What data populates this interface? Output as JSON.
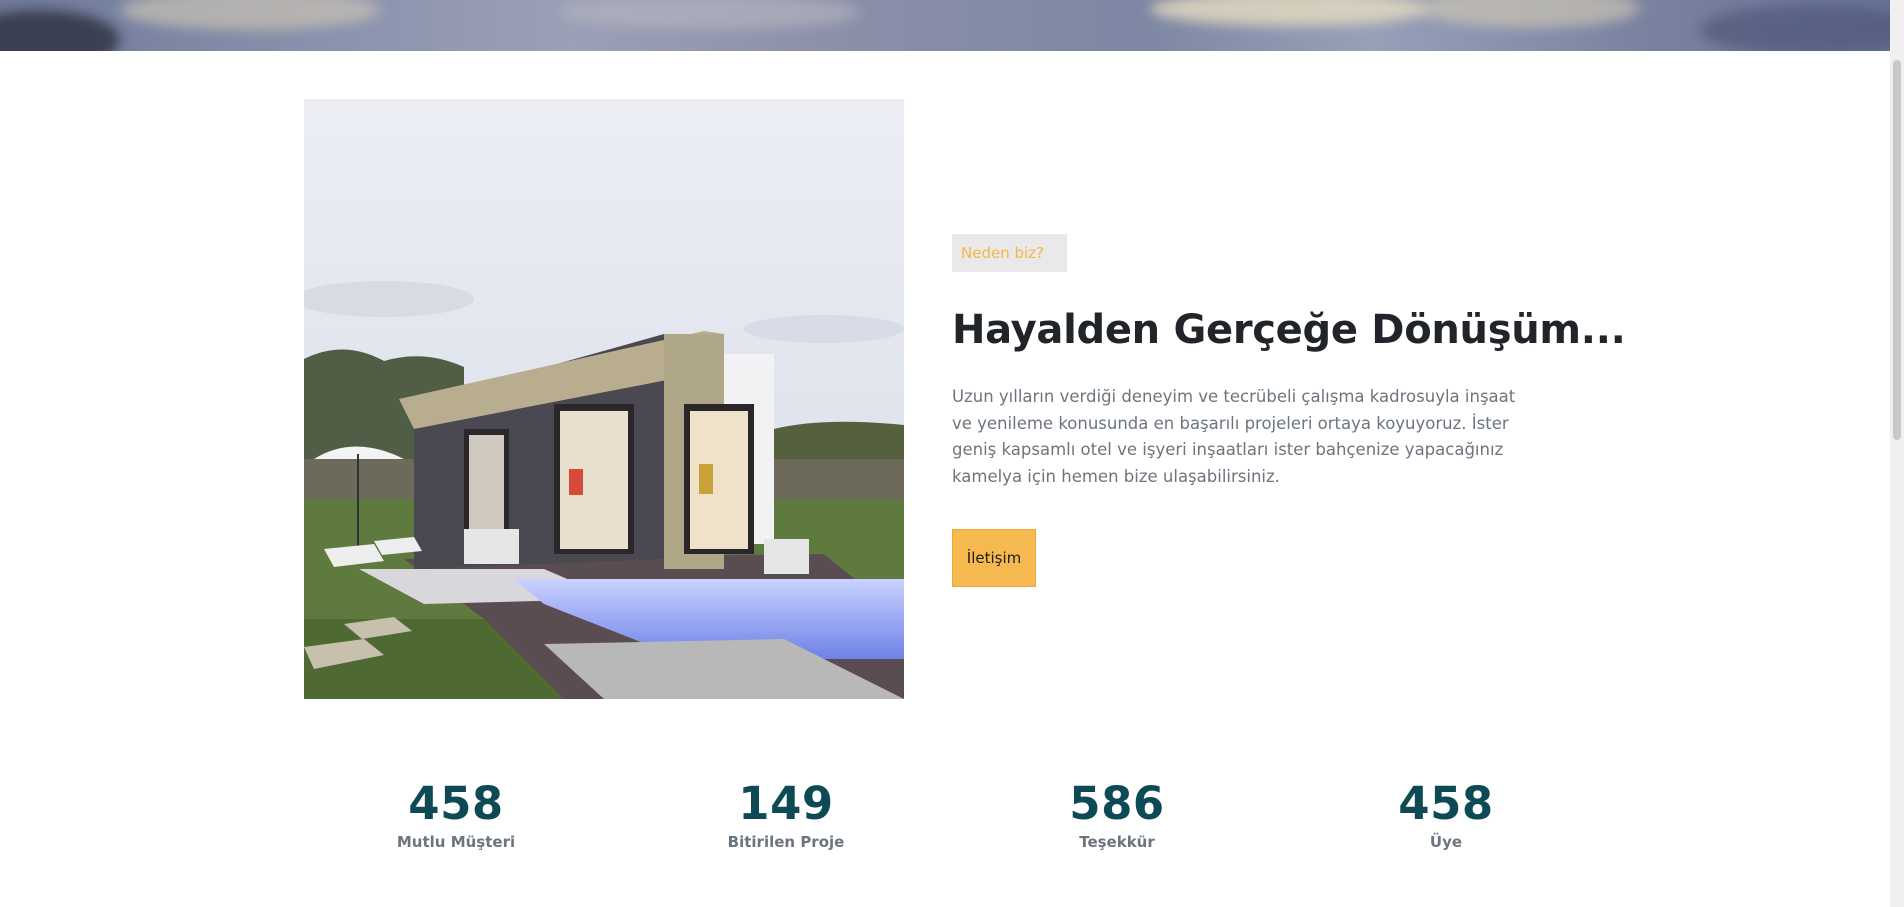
{
  "about": {
    "eyebrow": "Neden biz?",
    "heading": "Hayalden Gerçeğe Dönüşüm...",
    "description": "Uzun yılların verdiği deneyim ve tecrübeli çalışma kadrosuyla inşaat ve yenileme konusunda en başarılı projeleri ortaya koyuyoruz. İster geniş kapsamlı otel ve işyeri inşaatları ister bahçenize yapacağınız kamelya için hemen bize ulaşabilirsiniz.",
    "contact_button": "İletişim"
  },
  "stats": [
    {
      "value": "458",
      "label": "Mutlu Müşteri"
    },
    {
      "value": "149",
      "label": "Bitirilen Proje"
    },
    {
      "value": "586",
      "label": "Teşekkür"
    },
    {
      "value": "458",
      "label": "Üye"
    }
  ],
  "colors": {
    "accent": "#f6b950",
    "eyebrow_text": "#f6b54a",
    "heading": "#212529",
    "stat_value": "#0e4a55",
    "muted_text": "#6c757d"
  }
}
